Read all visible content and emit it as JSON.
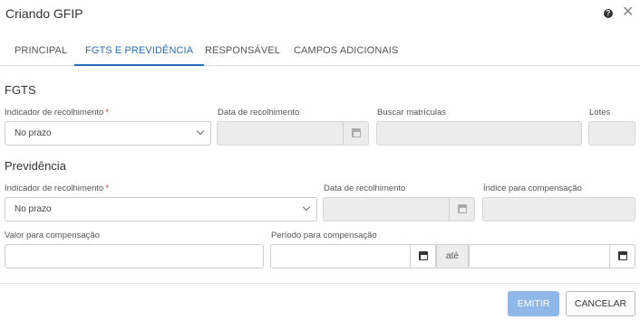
{
  "dialog": {
    "title": "Criando GFIP"
  },
  "tabs": [
    {
      "label": "PRINCIPAL"
    },
    {
      "label": "FGTS E PREVIDÊNCIA"
    },
    {
      "label": "RESPONSÁVEL"
    },
    {
      "label": "CAMPOS ADICIONAIS"
    }
  ],
  "fgts": {
    "section_title": "FGTS",
    "indicador_label": "Indicador de recolhimento",
    "indicador_value": "No prazo",
    "data_label": "Data de recolhimento",
    "matriculas_label": "Buscar matrículas",
    "lotes_label": "Lotes"
  },
  "previdencia": {
    "section_title": "Previdência",
    "indicador_label": "Indicador de recolhimento",
    "indicador_value": "No prazo",
    "data_label": "Data de recolhimento",
    "indice_label": "Índice para compensação",
    "valor_label": "Valor para compensação",
    "periodo_label": "Período para compensação",
    "ate": "até"
  },
  "required_marker": "*",
  "buttons": {
    "emit": "EMITIR",
    "cancel": "CANCELAR"
  },
  "icons": {
    "help": "question-circle-icon",
    "close": "close-icon",
    "calendar": "calendar-icon",
    "dropdown": "chevron-down-icon"
  },
  "colors": {
    "accent": "#2a6ebb",
    "primary_button_disabled": "#8fb8e8",
    "required": "#d33333"
  }
}
